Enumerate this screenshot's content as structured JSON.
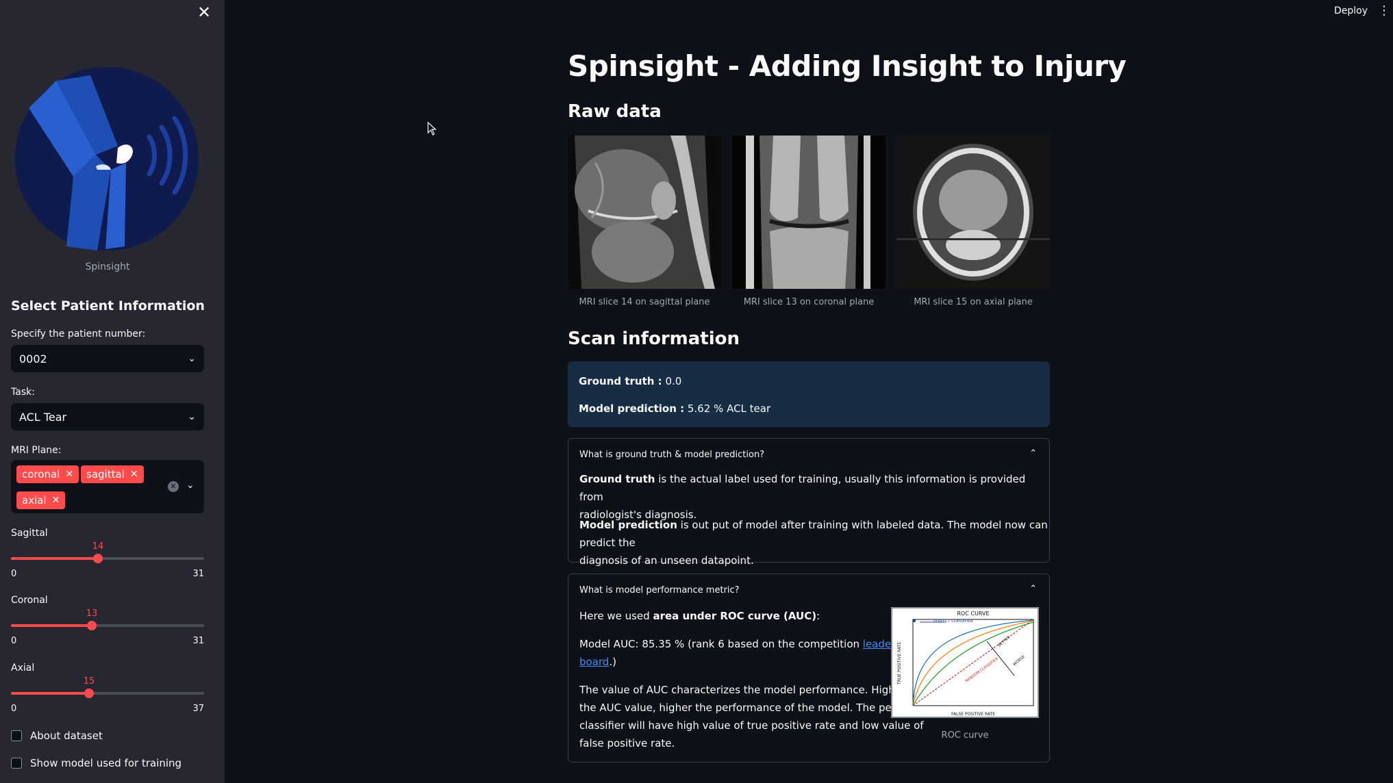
{
  "topbar": {
    "deploy_label": "Deploy",
    "menu_icon": "kebab-menu-icon"
  },
  "sidebar": {
    "close_icon": "close-icon",
    "logo_caption": "Spinsight",
    "header": "Select Patient Information",
    "patient": {
      "label": "Specify the patient number:",
      "value": "0002"
    },
    "task": {
      "label": "Task:",
      "value": "ACL Tear"
    },
    "plane": {
      "label": "MRI Plane:",
      "tags": [
        "coronal",
        "sagittal",
        "axial"
      ]
    },
    "sliders": {
      "sagittal": {
        "label": "Sagittal",
        "value": 14,
        "min": 0,
        "max": 31
      },
      "coronal": {
        "label": "Coronal",
        "value": 13,
        "min": 0,
        "max": 31
      },
      "axial": {
        "label": "Axial",
        "value": 15,
        "min": 0,
        "max": 37
      }
    },
    "checkboxes": {
      "about": "About dataset",
      "model": "Show model used for training"
    }
  },
  "main": {
    "title": "Spinsight - Adding Insight to Injury",
    "raw_header": "Raw data",
    "captions": {
      "sagittal": "MRI slice 14 on sagittal plane",
      "coronal": "MRI slice 13 on coronal plane",
      "axial": "MRI slice 15 on axial plane"
    },
    "scan_header": "Scan information",
    "ground_truth_label": "Ground truth :",
    "ground_truth_value": "0.0",
    "prediction_label": "Model prediction :",
    "prediction_value": "5.62 % ACL tear",
    "exp1": {
      "title": "What is ground truth & model prediction?",
      "gt_bold": "Ground truth",
      "gt_line1": " is the actual label used for training, usually this information is provided from",
      "gt_line2": "radiologist's diagnosis.",
      "mp_bold": "Model prediction",
      "mp_line1": " is out put of model after training with labeled data. The model now can predict the",
      "mp_line2": "diagnosis of an unseen datapoint."
    },
    "exp2": {
      "title": "What is model performance metric?",
      "intro_pre": "Here we used ",
      "intro_bold": "area under ROC curve (AUC)",
      "intro_post": ":",
      "auc_pre": "Model AUC: 85.35 % (rank 6 based on the competition ",
      "auc_link1": "leader",
      "auc_link2": "board",
      "auc_post": ".)",
      "desc1": "The value of AUC characterizes the model performance. Higher",
      "desc2": "the AUC value, higher the performance of the model. The perfect",
      "desc3": "classifier will have high value of true positive rate and low value of",
      "desc4": "false positive rate.",
      "roc_caption": "ROC curve",
      "roc_title": "ROC CURVE",
      "roc_perfect": "PERFECT CLASSIFIER",
      "roc_random": "RANDOM CLASSIFIER",
      "roc_better": "BETTER",
      "roc_worse": "WORSE",
      "roc_xlabel": "FALSE POSITIVE RATE",
      "roc_ylabel": "TRUE POSITIVE RATE"
    }
  }
}
